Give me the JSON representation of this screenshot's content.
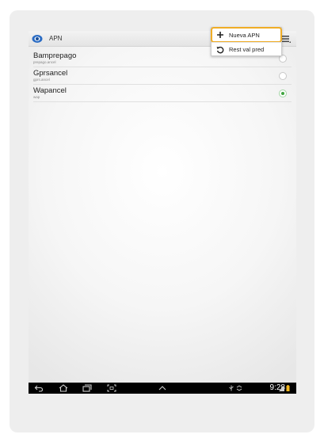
{
  "action_bar": {
    "title": "APN",
    "app_icon": "settings-app-icon",
    "overflow_icon": "overflow-menu-icon"
  },
  "apn_list": [
    {
      "name": "Bamprepago",
      "apn": "prepago.ancel",
      "selected": false
    },
    {
      "name": "Gprsancel",
      "apn": "gprs.ancel",
      "selected": false
    },
    {
      "name": "Wapancel",
      "apn": "wap",
      "selected": true
    }
  ],
  "overflow_menu": {
    "items": [
      {
        "label": "Nueva APN",
        "icon": "plus-icon",
        "highlighted": true
      },
      {
        "label": "Rest val pred",
        "icon": "reset-icon",
        "highlighted": false
      }
    ]
  },
  "nav_bar": {
    "buttons": [
      "back-icon",
      "home-icon",
      "recent-apps-icon",
      "screenshot-icon",
      "up-arrow-icon"
    ],
    "clock": "9:28",
    "status_icons": [
      "usb-icon",
      "sync-icon",
      "signal-icon",
      "battery-icon"
    ]
  },
  "colors": {
    "highlight": "#f0ad26",
    "radio_checked": "#3fa53f"
  }
}
